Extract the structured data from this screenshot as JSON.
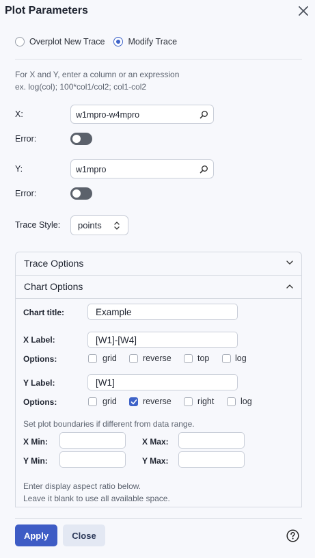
{
  "dialog": {
    "title": "Plot Parameters",
    "close_icon": "close-icon"
  },
  "mode": {
    "options": [
      "Overplot New Trace",
      "Modify Trace"
    ],
    "selected": "Modify Trace"
  },
  "hint": {
    "line1": "For X and Y, enter a column or an expression",
    "line2": "ex. log(col); 100*col1/col2; col1-col2"
  },
  "x": {
    "label": "X:",
    "value": "w1mpro-w4mpro",
    "icon": "search-icon"
  },
  "x_error": {
    "label": "Error:",
    "on": false
  },
  "y": {
    "label": "Y:",
    "value": "w1mpro",
    "icon": "search-icon"
  },
  "y_error": {
    "label": "Error:",
    "on": false
  },
  "trace_style": {
    "label": "Trace Style:",
    "value": "points"
  },
  "trace_options": {
    "title": "Trace Options",
    "expanded": false
  },
  "chart_options": {
    "title": "Chart Options",
    "expanded": true,
    "chart_title_label": "Chart title:",
    "chart_title_value": "Example",
    "x_label_label": "X Label:",
    "x_label_value": "[W1]-[W4]",
    "x_options_label": "Options:",
    "x_options": [
      {
        "label": "grid",
        "checked": false
      },
      {
        "label": "reverse",
        "checked": false
      },
      {
        "label": "top",
        "checked": false
      },
      {
        "label": "log",
        "checked": false
      }
    ],
    "y_label_label": "Y Label:",
    "y_label_value": "[W1]",
    "y_options_label": "Options:",
    "y_options": [
      {
        "label": "grid",
        "checked": false
      },
      {
        "label": "reverse",
        "checked": true
      },
      {
        "label": "right",
        "checked": false
      },
      {
        "label": "log",
        "checked": false
      }
    ],
    "bounds_hint": "Set plot boundaries if different from data range.",
    "xmin_label": "X Min:",
    "xmax_label": "X Max:",
    "ymin_label": "Y Min:",
    "ymax_label": "Y Max:",
    "xmin": "",
    "xmax": "",
    "ymin": "",
    "ymax": "",
    "aspect_hint_1": "Enter display aspect ratio below.",
    "aspect_hint_2": "Leave it blank to use all available space."
  },
  "footer": {
    "apply_label": "Apply",
    "close_label": "Close",
    "help_icon": "help-icon"
  },
  "colors": {
    "accent": "#3e5cc5",
    "toggle_off": "#5b616b",
    "background": "#f7f8fc"
  }
}
